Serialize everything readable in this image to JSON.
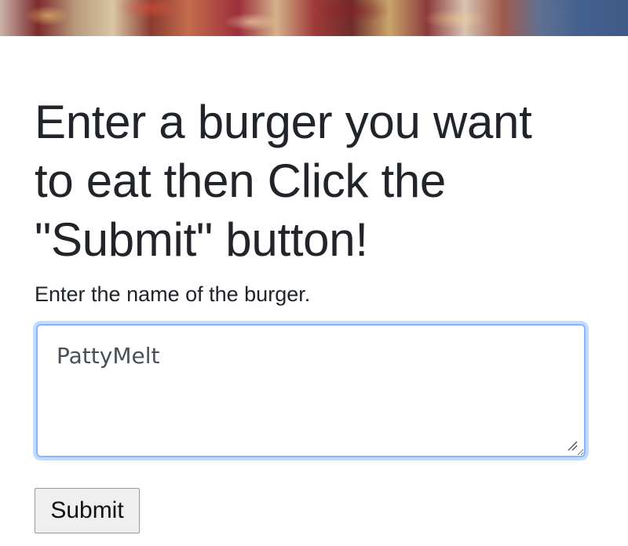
{
  "header_image": {
    "description_icon": "burger-photo-banner"
  },
  "form": {
    "heading": "Enter a burger you want to eat then Click the \"Submit\" button!",
    "label": "Enter the name of the burger.",
    "textarea_value": "PattyMelt",
    "submit_label": "Submit"
  },
  "colors": {
    "text": "#212529",
    "focus_border": "#86b7fe",
    "focus_glow": "rgba(13,110,253,0.25)",
    "button_bg": "#efefef"
  }
}
